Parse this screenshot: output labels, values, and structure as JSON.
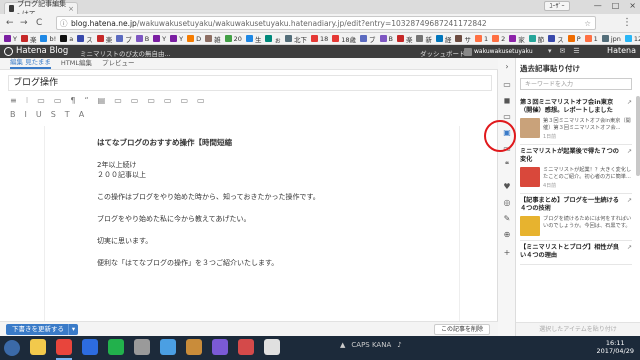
{
  "browser": {
    "tab_title": "ブログ記事編集 - はて",
    "tab_close": "×",
    "user_chip": "ﾕｰｻﾞｰ",
    "window_controls": [
      "—",
      "□",
      "×"
    ],
    "url_host": "blog.hatena.ne.jp",
    "url_path": "/wakuwakusetuyaku/wakuwakusetuyaku.hatenadiary.jp/edit?entry=10328749687241172842",
    "nav_back": "←",
    "nav_forward": "→",
    "nav_reload": "C",
    "bookmarks": [
      {
        "label": "Y",
        "color": "#7b1fa2"
      },
      {
        "label": "楽",
        "color": "#c62828"
      },
      {
        "label": "b!",
        "color": "#1e88e5"
      },
      {
        "label": "a",
        "color": "#111111"
      },
      {
        "label": "ス",
        "color": "#3949ab"
      },
      {
        "label": "楽",
        "color": "#c62828"
      },
      {
        "label": "ブ",
        "color": "#5c6bc0"
      },
      {
        "label": "B",
        "color": "#7e57c2"
      },
      {
        "label": "Y",
        "color": "#7b1fa2"
      },
      {
        "label": "Y",
        "color": "#7b1fa2"
      },
      {
        "label": "D",
        "color": "#f57c00"
      },
      {
        "label": "雑",
        "color": "#8d6e63"
      },
      {
        "label": "20",
        "color": "#43a047"
      },
      {
        "label": "生",
        "color": "#1e88e5"
      },
      {
        "label": "ぉ",
        "color": "#00897b"
      },
      {
        "label": "北下",
        "color": "#546e7a"
      },
      {
        "label": "18",
        "color": "#e53935"
      },
      {
        "label": "18歳",
        "color": "#e53935"
      },
      {
        "label": "ブ",
        "color": "#5c6bc0"
      },
      {
        "label": "B",
        "color": "#7e57c2"
      },
      {
        "label": "楽",
        "color": "#c62828"
      },
      {
        "label": "新",
        "color": "#757575"
      },
      {
        "label": "経",
        "color": "#0277bd"
      },
      {
        "label": "サ",
        "color": "#6d4c41"
      },
      {
        "label": "1",
        "color": "#ff7043"
      },
      {
        "label": "2",
        "color": "#ff7043"
      },
      {
        "label": "家",
        "color": "#8e24aa"
      },
      {
        "label": "節",
        "color": "#26a69a"
      },
      {
        "label": "ス",
        "color": "#3949ab"
      },
      {
        "label": "P",
        "color": "#ef6c00"
      },
      {
        "label": "1",
        "color": "#ff7043"
      },
      {
        "label": "jpn",
        "color": "#546e7a"
      },
      {
        "label": "12",
        "color": "#29b6f6"
      },
      {
        "label": "T",
        "color": "#0d47a1"
      }
    ]
  },
  "hatena": {
    "logo": "Hatena Blog",
    "blog_name": "ミニマリストのび太の無自由...",
    "dashboard": "ダッシュボード",
    "user": "wakuwakusetuyaku",
    "right_logo": "Hatena",
    "header_icons": [
      "▾",
      "✉",
      "☰"
    ]
  },
  "editor": {
    "tabs": [
      "編集 見たまま",
      "HTML編集",
      "プレビュー"
    ],
    "title_value": "ブログ操作",
    "toolbar_row1": [
      "≡",
      "⁝",
      "▭",
      "▭",
      "¶",
      "“",
      "▤",
      "▭",
      "▭",
      "▭",
      "▭",
      "▭",
      "▭"
    ],
    "toolbar_row2": [
      "B",
      "I",
      "U",
      "S",
      "T",
      "A"
    ],
    "body_lines": [
      {
        "text": "はてなブログのおすすめ操作【時間短縮",
        "bold": true
      },
      {
        "text": "2年以上続け",
        "bold": false,
        "dense": true
      },
      {
        "text": "２００記事以上",
        "bold": false
      },
      {
        "text": "この操作はブログをやり始めた時から、知っておきたかった操作です。",
        "bold": false
      },
      {
        "text": "ブログをやり始めた私に今から教えてあげたい。",
        "bold": false
      },
      {
        "text": "切実に思います。",
        "bold": false
      },
      {
        "text": "便利な「はてなブログの操作」を３つご紹介いたします。",
        "bold": false
      }
    ],
    "update_button": "下書きを更新する",
    "update_dropdown": "▾",
    "delete_button": "この記事を削除"
  },
  "rail": {
    "icons": [
      "›",
      "▭",
      "◼",
      "▭",
      "▣",
      "▭",
      "❝",
      "♥",
      "◎",
      "✎",
      "⊕",
      "+"
    ]
  },
  "sidebar": {
    "title": "過去記事貼り付け",
    "search_placeholder": "キーワードを入力",
    "ext_icon": "↗",
    "cards": [
      {
        "title": "第３回ミニマリストオフ会in東京（開催）感想。レポートしました",
        "desc": "第３回ミニマリストオフ会in東京（開催）第３回ミニマリストオフ会...",
        "ago": "1日前",
        "thumb": "#c9a27a"
      },
      {
        "title": "ミニマリストが起業後で得た７つの変化",
        "desc": "ミニマリストが起業！？大きく変化したことのご紹介。初心者の方に簡単...",
        "ago": "4日前",
        "thumb": "#d9483b"
      },
      {
        "title": "【記事まとめ】ブログを一生続ける４つの技術",
        "desc": "ブログを続けるためには何をすればいいのでしょうか。今回は、石黒です。",
        "ago": "",
        "thumb": "#e7b32f"
      },
      {
        "title": "【ミニマリストとブログ】相性が良い４つの理由",
        "desc": "",
        "ago": "",
        "thumb": "#7fa3c4"
      }
    ],
    "paste_selected": "選択したアイテムを貼り付け"
  },
  "taskbar": {
    "apps": [
      {
        "name": "explorer",
        "color": "#f2c94c"
      },
      {
        "name": "chrome",
        "color": "#e8453c"
      },
      {
        "name": "firefox",
        "color": "#2d6cdf"
      },
      {
        "name": "line",
        "color": "#22b14c"
      },
      {
        "name": "media",
        "color": "#9a9a9a"
      },
      {
        "name": "paint",
        "color": "#4b9fe3"
      },
      {
        "name": "app",
        "color": "#c98c3a"
      },
      {
        "name": "app2",
        "color": "#7a5ad6"
      },
      {
        "name": "app3",
        "color": "#d44a4a"
      },
      {
        "name": "app4",
        "color": "#e0e0e0"
      }
    ],
    "tray_text": "CAPS KANA",
    "time": "16:11",
    "date": "2017/04/29"
  }
}
